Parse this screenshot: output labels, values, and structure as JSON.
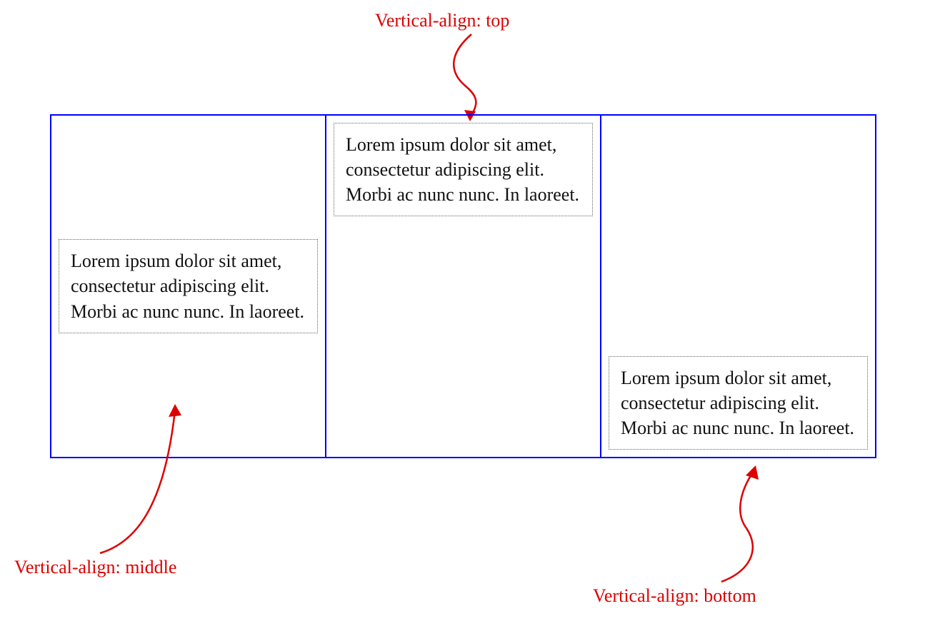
{
  "annotations": {
    "top": "Vertical-align: top",
    "middle": "Vertical-align: middle",
    "bottom": "Vertical-align: bottom"
  },
  "cells": {
    "middle": {
      "text": "Lorem ipsum dolor sit amet, consectetur adipiscing elit. Morbi ac nunc nunc. In laoreet."
    },
    "top": {
      "text": "Lorem ipsum dolor sit amet, consectetur adipiscing elit. Morbi ac nunc nunc. In laoreet."
    },
    "bottom": {
      "text": "Lorem ipsum dolor sit amet, consectetur adipiscing elit. Morbi ac nunc nunc. In laoreet."
    }
  },
  "colors": {
    "annotation": "#d00",
    "cellBorder": "#00f",
    "dotted": "#666"
  }
}
